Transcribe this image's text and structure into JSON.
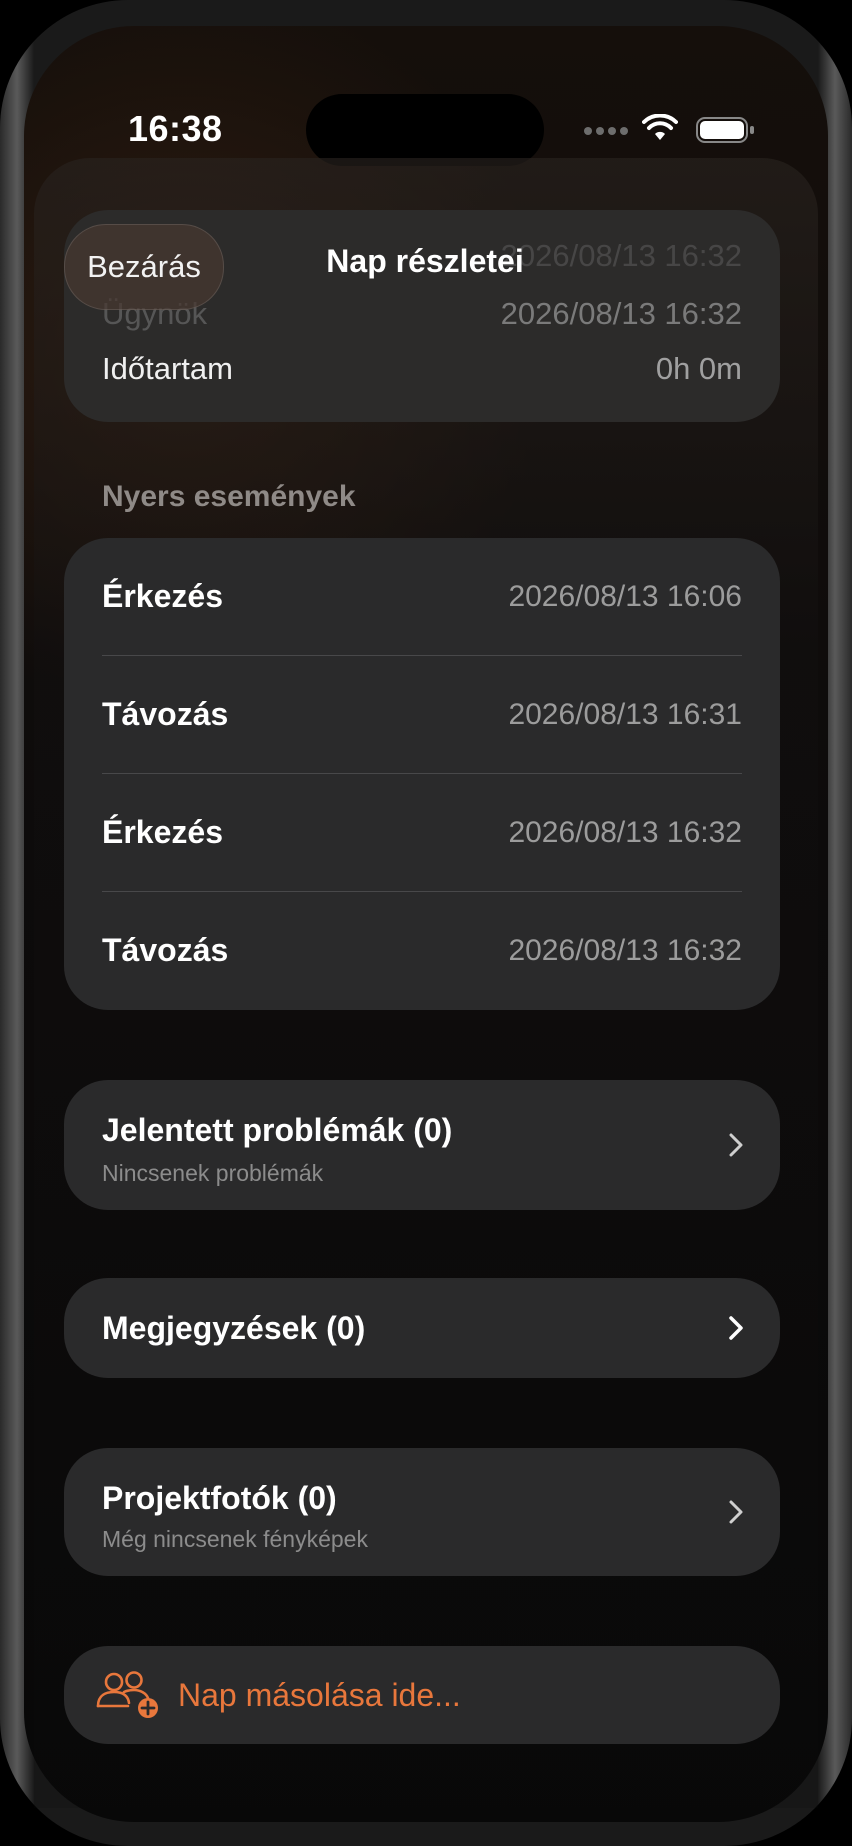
{
  "status": {
    "time": "16:38"
  },
  "header": {
    "close_label": "Bezárás",
    "title": "Nap részletei"
  },
  "summary": {
    "hidden_value": "2026/08/13 16:32",
    "agent_label": "Ügynök",
    "agent_value": "2026/08/13 16:32",
    "duration_label": "Időtartam",
    "duration_value": "0h 0m"
  },
  "raw_events": {
    "section_title": "Nyers események",
    "items": [
      {
        "type": "Érkezés",
        "time": "2026/08/13 16:06"
      },
      {
        "type": "Távozás",
        "time": "2026/08/13 16:31"
      },
      {
        "type": "Érkezés",
        "time": "2026/08/13 16:32"
      },
      {
        "type": "Távozás",
        "time": "2026/08/13 16:32"
      }
    ]
  },
  "issues": {
    "title": "Jelentett problémák (0)",
    "subtitle": "Nincsenek problémák"
  },
  "notes": {
    "title": "Megjegyzések (0)"
  },
  "photos": {
    "title": "Projektfotók (0)",
    "subtitle": "Még nincsenek fényképek"
  },
  "copy_day": {
    "label": "Nap másolása ide...",
    "icon": "people-add-icon"
  },
  "colors": {
    "accent": "#E8773C",
    "card": "#2A2A2B",
    "background": "#0D0B0B"
  }
}
